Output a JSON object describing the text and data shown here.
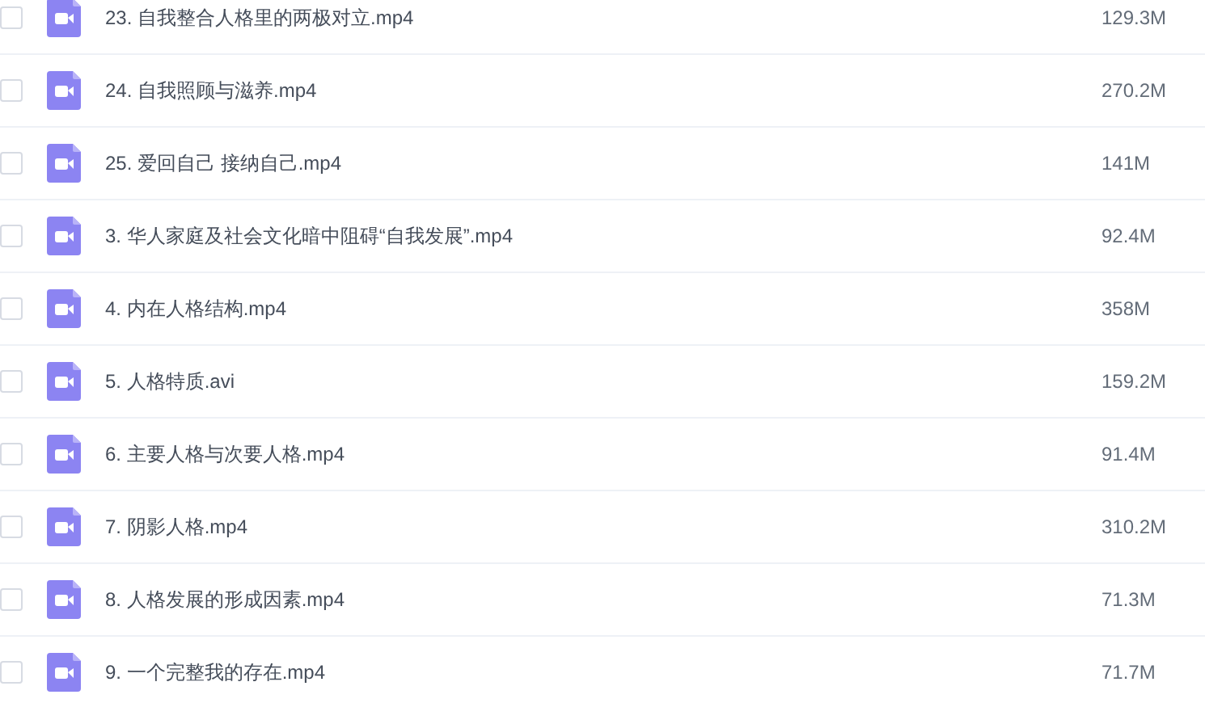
{
  "files": [
    {
      "name": "23. 自我整合人格里的两极对立.mp4",
      "size": "129.3M",
      "checked": false
    },
    {
      "name": "24. 自我照顾与滋养.mp4",
      "size": "270.2M",
      "checked": false
    },
    {
      "name": "25. 爱回自己 接纳自己.mp4",
      "size": "141M",
      "checked": false
    },
    {
      "name": "3. 华人家庭及社会文化暗中阻碍“自我发展”.mp4",
      "size": "92.4M",
      "checked": false
    },
    {
      "name": "4. 内在人格结构.mp4",
      "size": "358M",
      "checked": false
    },
    {
      "name": "5. 人格特质.avi",
      "size": "159.2M",
      "checked": false
    },
    {
      "name": "6. 主要人格与次要人格.mp4",
      "size": "91.4M",
      "checked": false
    },
    {
      "name": "7. 阴影人格.mp4",
      "size": "310.2M",
      "checked": false
    },
    {
      "name": "8. 人格发展的形成因素.mp4",
      "size": "71.3M",
      "checked": false
    },
    {
      "name": "9. 一个完整我的存在.mp4",
      "size": "71.7M",
      "checked": false
    }
  ]
}
